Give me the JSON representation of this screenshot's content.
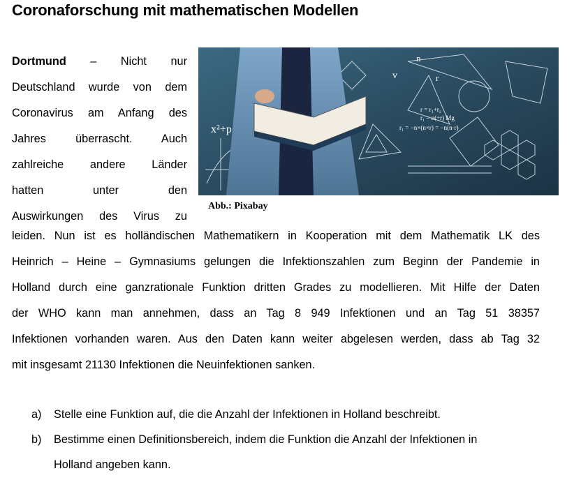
{
  "document": {
    "title": "Coronaforschung mit mathematischen Modellen",
    "location": "Dortmund",
    "intro_lines": [
      " – Nicht nur",
      "Deutschland wurde von dem",
      "Coronavirus am Anfang des",
      "Jahres überrascht. Auch",
      "zahlreiche andere Länder",
      "hatten unter den",
      "Auswirkungen des Virus zu"
    ],
    "caption": "Abb.: Pixabay",
    "figure_text": {
      "formula1": "x²+p",
      "formula2": "r = r₁+r₂",
      "formula3": "r₁ = n(÷r)   Mg",
      "formula4": "r₁ = −n×(n×r) = −n(n·r)",
      "label_v": "v",
      "label_n": "n",
      "label_r": "r"
    },
    "body_lines": [
      "leiden. Nun ist es holländischen Mathematikern in Kooperation mit dem Mathematik LK des",
      "Heinrich – Heine – Gymnasiums gelungen die Infektionszahlen zum Beginn der Pandemie in",
      "Holland durch eine ganzrationale Funktion dritten Grades zu modellieren. Mit Hilfe der Daten",
      "der WHO kann man annehmen, dass an Tag 8 949 Infektionen und an Tag 51 38357",
      "Infektionen vorhanden waren. Aus den Daten kann weiter abgelesen werden, dass ab Tag 32",
      "mit insgesamt 21130 Infektionen die Neuinfektionen sanken."
    ],
    "tasks": [
      {
        "mark": "a)",
        "lines": [
          "Stelle eine Funktion auf, die die Anzahl der Infektionen in Holland beschreibt."
        ]
      },
      {
        "mark": "b)",
        "lines": [
          "Bestimme einen Definitionsbereich, indem die Funktion die Anzahl der Infektionen in",
          "Holland angeben kann."
        ]
      }
    ]
  }
}
